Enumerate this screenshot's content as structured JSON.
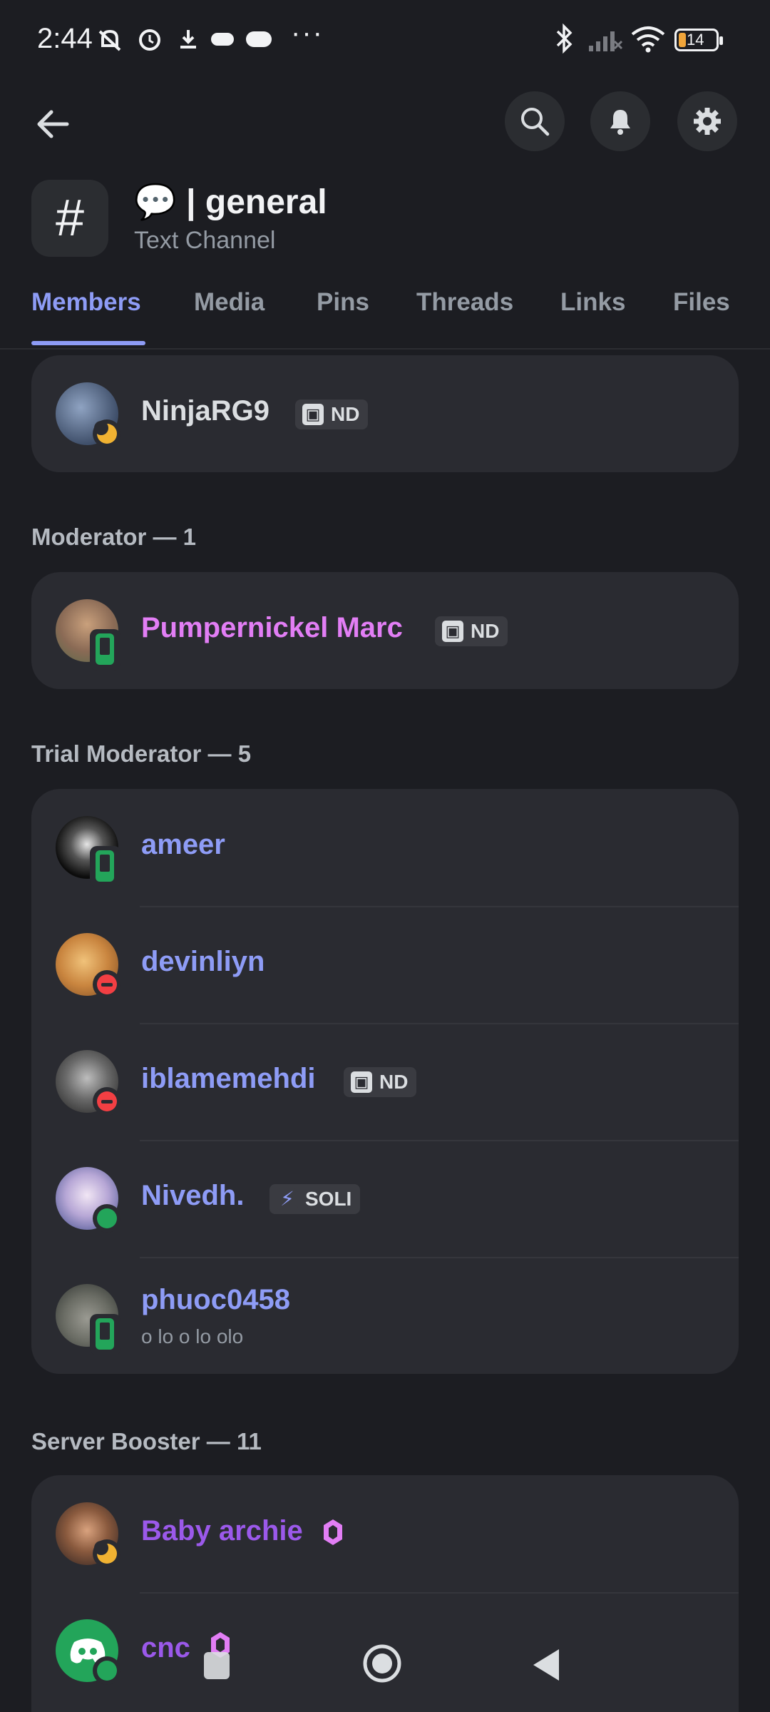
{
  "status_bar": {
    "time": "2:44",
    "icons_left": [
      "mute-vibrate-icon",
      "alarm-icon",
      "download-icon",
      "game-controller-icon",
      "game-controller-icon",
      "more-icon"
    ],
    "icons_right": [
      "bluetooth-icon",
      "signal-icon",
      "wifi-icon"
    ],
    "battery": "14"
  },
  "header": {
    "back_icon": "arrow-left-icon",
    "actions": [
      "search-icon",
      "bell-icon",
      "gear-icon"
    ]
  },
  "channel": {
    "icon": "#",
    "emoji": "💬",
    "name": "| general",
    "type": "Text Channel"
  },
  "tabs": [
    {
      "label": "Members",
      "active": true
    },
    {
      "label": "Media"
    },
    {
      "label": "Pins"
    },
    {
      "label": "Threads"
    },
    {
      "label": "Links"
    },
    {
      "label": "Files"
    }
  ],
  "top_member": {
    "name": "NinjaRG9",
    "tag": "ND",
    "status": "idle"
  },
  "sections": [
    {
      "title": "Moderator — 1",
      "members": [
        {
          "name": "Pumpernickel Marc",
          "tag": "ND",
          "status": "mobile"
        }
      ]
    },
    {
      "title": "Trial Moderator — 5",
      "members": [
        {
          "name": "ameer",
          "status": "mobile"
        },
        {
          "name": "devinliyn",
          "status": "dnd"
        },
        {
          "name": "iblamemehdi",
          "tag": "ND",
          "status": "dnd"
        },
        {
          "name": "Nivedh.",
          "tag": "SOLI",
          "status": "online"
        },
        {
          "name": "phuoc0458",
          "substatus": "o lo o lo olo",
          "status": "mobile"
        }
      ]
    },
    {
      "title": "Server Booster — 11",
      "members": [
        {
          "name": "Baby archie",
          "status": "idle",
          "booster": true
        },
        {
          "name": "cnc",
          "status": "online",
          "booster": true
        }
      ]
    }
  ],
  "colors": {
    "background": "#1c1d22",
    "card": "#2a2b31",
    "accent": "#8e9cf6",
    "moderator": "#e27ef5",
    "booster": "#9b59ea",
    "online": "#23a55a",
    "dnd": "#f23f43",
    "idle": "#f0b232"
  },
  "nav_bar": [
    "recents-icon",
    "home-icon",
    "back-icon"
  ]
}
